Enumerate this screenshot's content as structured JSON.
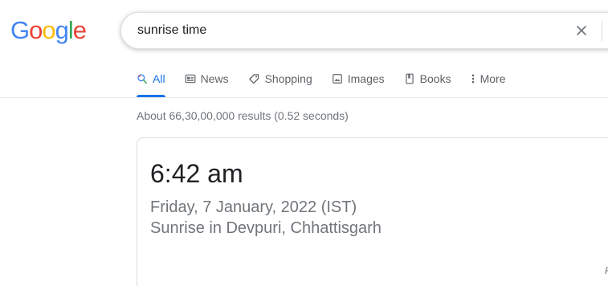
{
  "logo": {
    "letters": [
      "G",
      "o",
      "o",
      "g",
      "l",
      "e"
    ],
    "colors": [
      "#4285F4",
      "#EA4335",
      "#FBBC05",
      "#4285F4",
      "#34A853",
      "#EA4335"
    ]
  },
  "search": {
    "query": "sunrise time",
    "clear_icon": "close-icon"
  },
  "tabs": [
    {
      "label": "All",
      "icon": "search-icon",
      "active": true
    },
    {
      "label": "News",
      "icon": "news-icon",
      "active": false
    },
    {
      "label": "Shopping",
      "icon": "tag-icon",
      "active": false
    },
    {
      "label": "Images",
      "icon": "image-icon",
      "active": false
    },
    {
      "label": "Books",
      "icon": "book-icon",
      "active": false
    },
    {
      "label": "More",
      "icon": "more-vert-icon",
      "active": false
    }
  ],
  "results": {
    "stats": "About 66,30,00,000 results (0.52 seconds)"
  },
  "answer_card": {
    "time": "6:42 am",
    "date": "Friday, 7 January, 2022 (IST)",
    "location": "Sunrise in Devpuri, Chhattisgarh",
    "feedback": "F"
  },
  "colors": {
    "accent": "#1a73e8",
    "muted_text": "#70757a",
    "tab_text": "#5f6368"
  }
}
